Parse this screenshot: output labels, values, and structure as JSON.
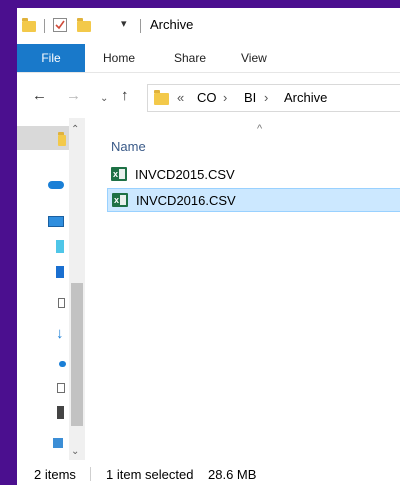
{
  "window": {
    "title": "Archive"
  },
  "ribbon": {
    "tabs": [
      "File",
      "Home",
      "Share",
      "View"
    ]
  },
  "address": {
    "overflow": "«",
    "crumbs": [
      "CO",
      "BI",
      "Archive"
    ]
  },
  "list": {
    "column_name": "Name",
    "files": [
      {
        "name": "INVCD2015.CSV",
        "selected": false
      },
      {
        "name": "INVCD2016.CSV",
        "selected": true
      }
    ]
  },
  "status": {
    "items": "2 items",
    "selection": "1 item selected",
    "size": "28.6 MB"
  },
  "colors": {
    "accent": "#1979ca",
    "selection": "#cce8ff",
    "desktop": "#4b0f8f"
  }
}
